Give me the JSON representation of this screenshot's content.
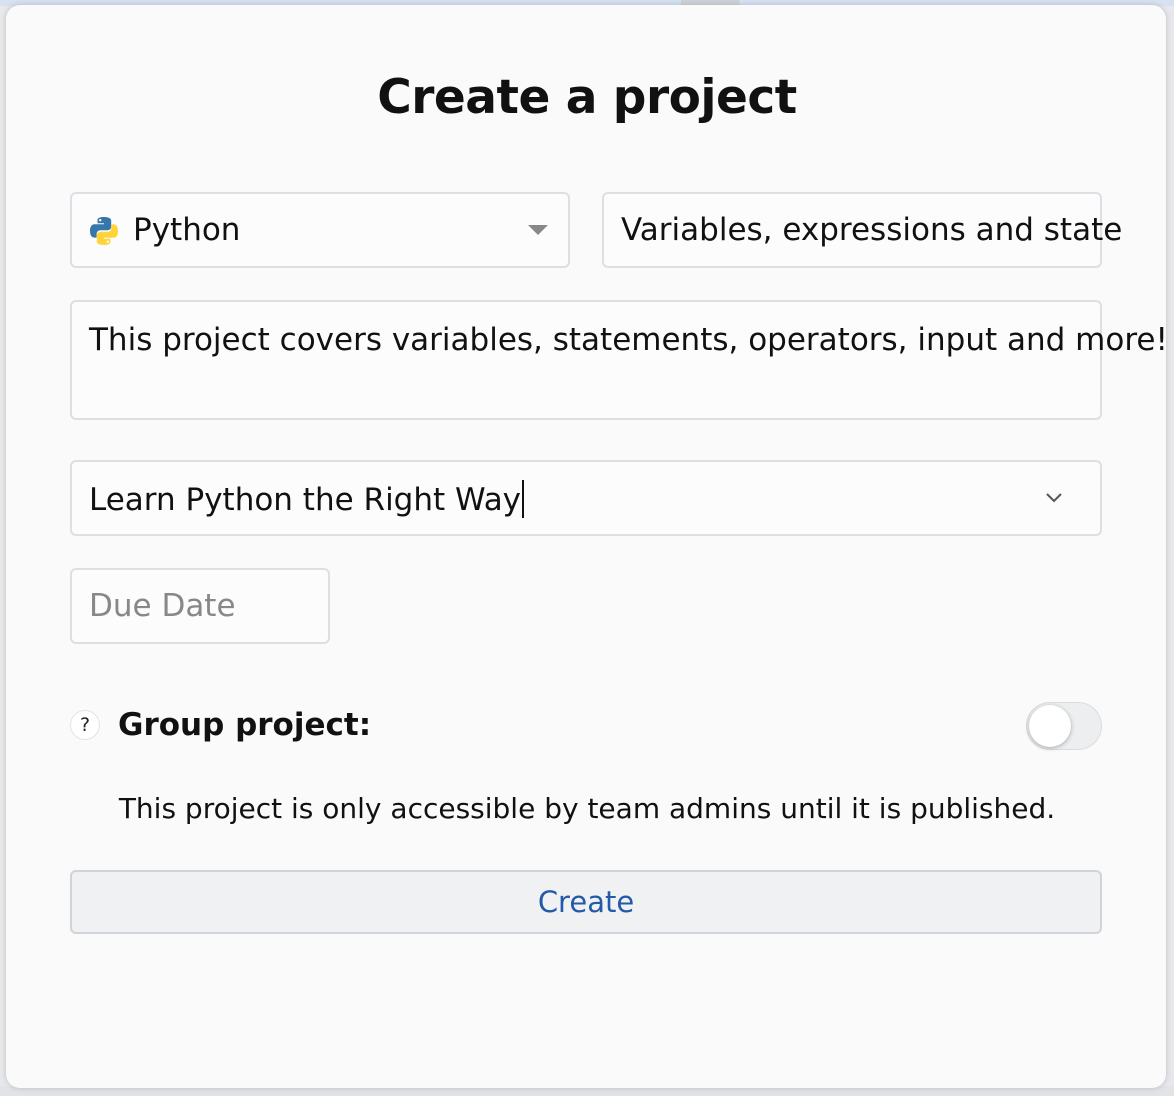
{
  "dialog": {
    "title": "Create a project",
    "language": {
      "selected": "Python",
      "icon": "python-logo-icon"
    },
    "project_title": {
      "value": "Variables, expressions and state"
    },
    "description": {
      "value": "This project covers variables, statements, operators, input and more!"
    },
    "curriculum": {
      "value": "Learn Python the Right Way",
      "icon": "chevron-down-icon"
    },
    "due_date": {
      "placeholder": "Due Date"
    },
    "group_project": {
      "help_label": "?",
      "label": "Group project:",
      "enabled": false
    },
    "notice": "This project is only accessible by team admins until it is published.",
    "create_label": "Create"
  },
  "colors": {
    "accent": "#2259a9",
    "python_blue": "#3776ab",
    "python_yellow": "#ffd43b"
  }
}
